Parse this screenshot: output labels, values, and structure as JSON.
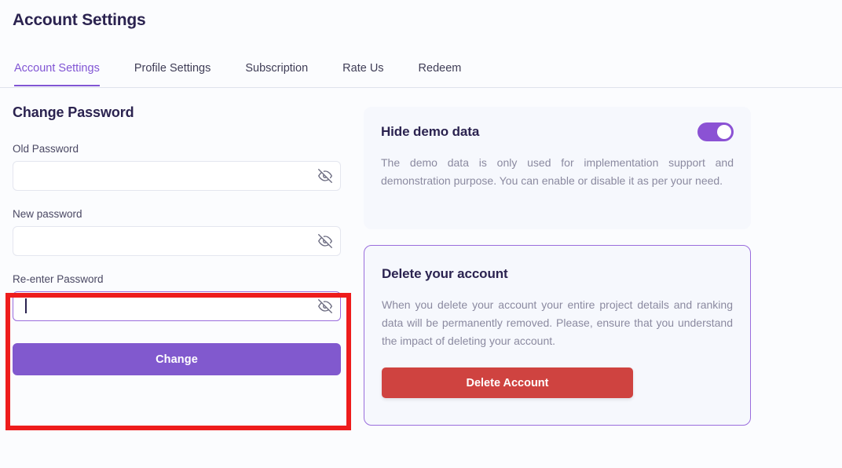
{
  "header": {
    "title": "Account Settings"
  },
  "tabs": {
    "items": [
      {
        "label": "Account Settings",
        "active": true
      },
      {
        "label": "Profile Settings",
        "active": false
      },
      {
        "label": "Subscription",
        "active": false
      },
      {
        "label": "Rate Us",
        "active": false
      },
      {
        "label": "Redeem",
        "active": false
      }
    ]
  },
  "change_password": {
    "section_title": "Change Password",
    "fields": [
      {
        "label": "Old Password",
        "value": "",
        "placeholder": "",
        "toggle_icon": "eye-off-icon",
        "focused": false
      },
      {
        "label": "New password",
        "value": "",
        "placeholder": "",
        "toggle_icon": "eye-off-icon",
        "focused": false
      },
      {
        "label": "Re-enter Password",
        "value": "",
        "placeholder": "",
        "toggle_icon": "eye-off-icon",
        "focused": true
      }
    ],
    "submit_label": "Change"
  },
  "demo_card": {
    "title": "Hide demo data",
    "description": "The demo data is only used for implementation support and demonstration purpose. You can enable or disable it as per your need.",
    "toggle_on": true
  },
  "delete_card": {
    "title": "Delete your account",
    "description": "When you delete your account your entire project details and ranking data will be permanently removed. Please, ensure that you understand the impact of deleting your account.",
    "button_label": "Delete Account"
  },
  "colors": {
    "accent_purple": "#8155d4",
    "button_purple": "#8159ce",
    "toggle_purple": "#8b52d4",
    "danger_red": "#cf4340",
    "annotation_red": "#ee1c1c",
    "title_navy": "#2b2350",
    "card_bg": "#f6f8fd",
    "page_bg": "#fbfcfe"
  }
}
